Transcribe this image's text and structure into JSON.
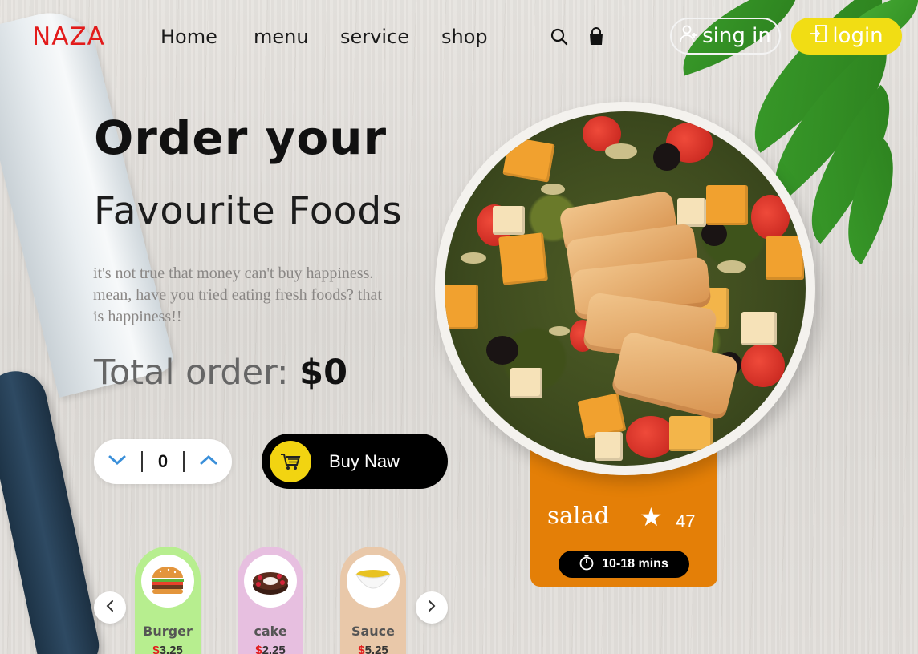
{
  "brand": {
    "logo": "NAZA"
  },
  "nav": {
    "items": [
      {
        "label": "Home"
      },
      {
        "label": "menu"
      },
      {
        "label": "service"
      },
      {
        "label": "shop"
      }
    ],
    "signin_label": "sing in",
    "login_label": "login"
  },
  "hero": {
    "title_line1": "Order your",
    "title_line2": "Favourite Foods",
    "description": "it's not true that money can't buy happiness. mean, have you tried eating fresh foods? that is happiness!!",
    "total_label": "Total order:",
    "total_value": "$0"
  },
  "stepper": {
    "quantity": "0"
  },
  "buy_button": {
    "label": "Buy Naw"
  },
  "featured": {
    "name": "salad",
    "rating": "47",
    "time": "10-18 mins"
  },
  "carousel": {
    "items": [
      {
        "name": "Burger",
        "currency": "$",
        "price": "3.25",
        "color": "#b7ee8f"
      },
      {
        "name": "cake",
        "currency": "$",
        "price": "2.25",
        "color": "#e7bfe0"
      },
      {
        "name": "Sauce",
        "currency": "$",
        "price": "5.25",
        "color": "#e9c8a9"
      }
    ]
  },
  "colors": {
    "logo": "#e21b1b",
    "accent_yellow": "#f1dd14",
    "card_orange": "#e47f07"
  }
}
